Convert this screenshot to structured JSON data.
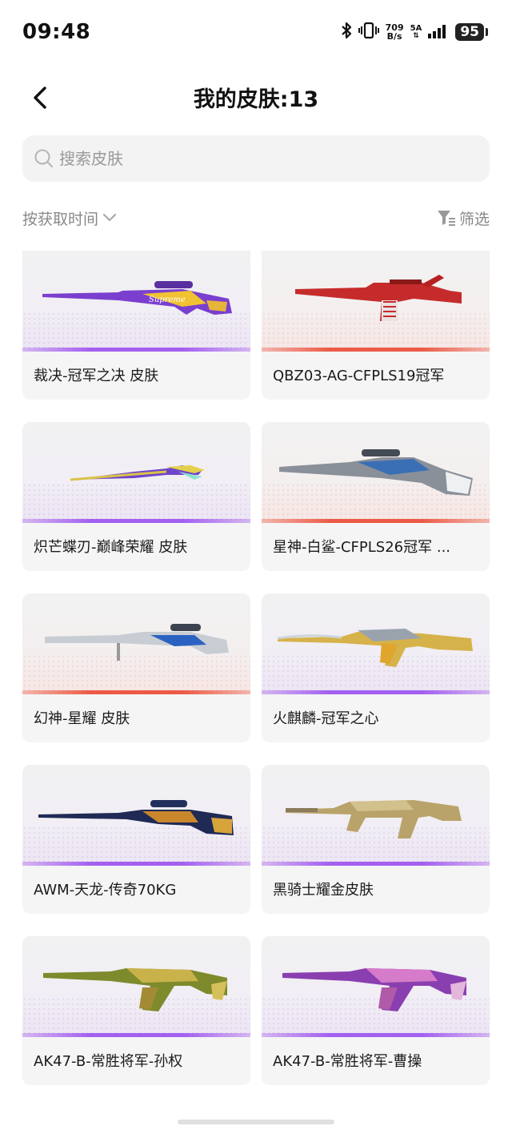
{
  "status_bar": {
    "time": "09:48",
    "net_speed_value": "709",
    "net_speed_unit": "B/s",
    "network_type": "5A",
    "battery": "95"
  },
  "header": {
    "title": "我的皮肤:13"
  },
  "search": {
    "placeholder": "搜索皮肤"
  },
  "toolbar": {
    "sort_label": "按获取时间",
    "filter_label": "筛选"
  },
  "skins": [
    {
      "name": "裁决-冠军之决 皮肤",
      "rarity_color": "#a35ff0",
      "icon": "sniper-rifle-purple"
    },
    {
      "name": "QBZ03-AG-CFPLS19冠军",
      "rarity_color": "#ec5a46",
      "icon": "assault-rifle-red"
    },
    {
      "name": "炽芒蝶刃-巅峰荣耀 皮肤",
      "rarity_color": "#a35ff0",
      "icon": "butterfly-knife"
    },
    {
      "name": "星神-白鲨-CFPLS26冠军 ...",
      "rarity_color": "#ec5a46",
      "icon": "sniper-rifle-silver"
    },
    {
      "name": "幻神-星耀 皮肤",
      "rarity_color": "#ec5a46",
      "icon": "sniper-rifle-chrome"
    },
    {
      "name": "火麒麟-冠军之心",
      "rarity_color": "#a35ff0",
      "icon": "ak-rifle-gold-blade"
    },
    {
      "name": "AWM-天龙-传奇70KG",
      "rarity_color": "#a35ff0",
      "icon": "awm-sniper-dragon"
    },
    {
      "name": "黑骑士耀金皮肤",
      "rarity_color": "#a35ff0",
      "icon": "m4-rifle-gold"
    },
    {
      "name": "AK47-B-常胜将军-孙权",
      "rarity_color": "#a35ff0",
      "icon": "ak47-green-gold"
    },
    {
      "name": "AK47-B-常胜将军-曹操",
      "rarity_color": "#a35ff0",
      "icon": "ak47-purple"
    }
  ]
}
